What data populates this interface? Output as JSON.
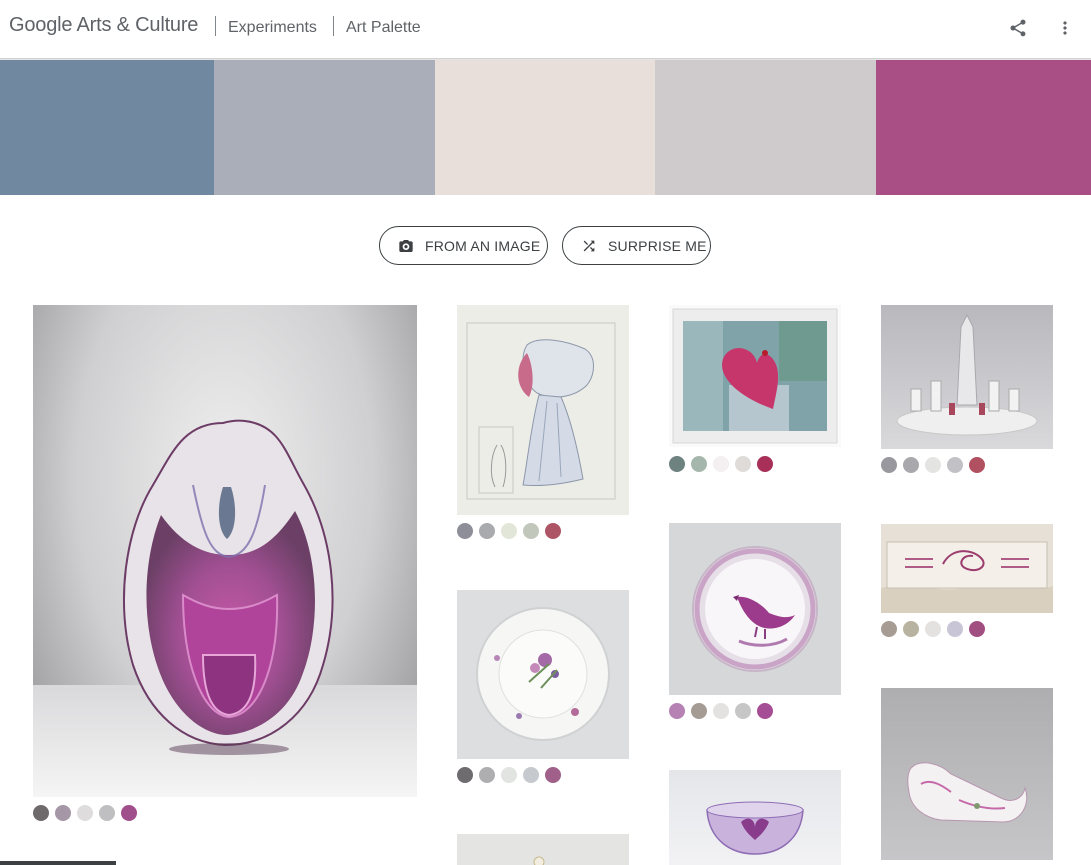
{
  "header": {
    "logo": "Google Arts & Culture",
    "crumbs": [
      "Experiments",
      "Art Palette"
    ],
    "share_icon": "share-icon",
    "menu_icon": "more-vert-icon"
  },
  "palette": [
    "#7089a1",
    "#a9aeb8",
    "#e8dfdb",
    "#cfcbcc",
    "#a94f85"
  ],
  "buttons": {
    "from_image": "FROM AN IMAGE",
    "from_image_icon": "camera-icon",
    "surprise": "SURPRISE ME",
    "surprise_icon": "shuffle-icon"
  },
  "artworks": [
    {
      "name": "glass-sculpture",
      "colors": [
        "#6e6a6c",
        "#a597a5",
        "#dedcdc",
        "#bfbfc1",
        "#a14f8a"
      ]
    },
    {
      "name": "bonnet-drawing",
      "colors": [
        "#8e8e98",
        "#a8aaad",
        "#e2e6d8",
        "#c1c7bb",
        "#ad5565"
      ]
    },
    {
      "name": "heart-collage",
      "colors": [
        "#6e8280",
        "#a5b7ad",
        "#f4f0f2",
        "#dedbd8",
        "#a83058"
      ]
    },
    {
      "name": "crystal-castle",
      "colors": [
        "#98989e",
        "#a8a8ad",
        "#e4e4e2",
        "#c2c2c6",
        "#b05060"
      ]
    },
    {
      "name": "floral-plate",
      "colors": [
        "#6e6c6e",
        "#aeaeb0",
        "#e2e4e2",
        "#c6c9ce",
        "#a0608a"
      ]
    },
    {
      "name": "bird-bowl",
      "colors": [
        "#b582b3",
        "#a49b94",
        "#e4e2e0",
        "#c6c6c6",
        "#a54e96"
      ]
    },
    {
      "name": "fabric-label",
      "colors": [
        "#a79c93",
        "#b8b3a0",
        "#e4e2e0",
        "#c8c6d6",
        "#a14f81"
      ]
    },
    {
      "name": "violet-bowl",
      "colors": []
    },
    {
      "name": "porcelain-sleigh",
      "colors": []
    },
    {
      "name": "partial-artwork",
      "colors": []
    }
  ]
}
